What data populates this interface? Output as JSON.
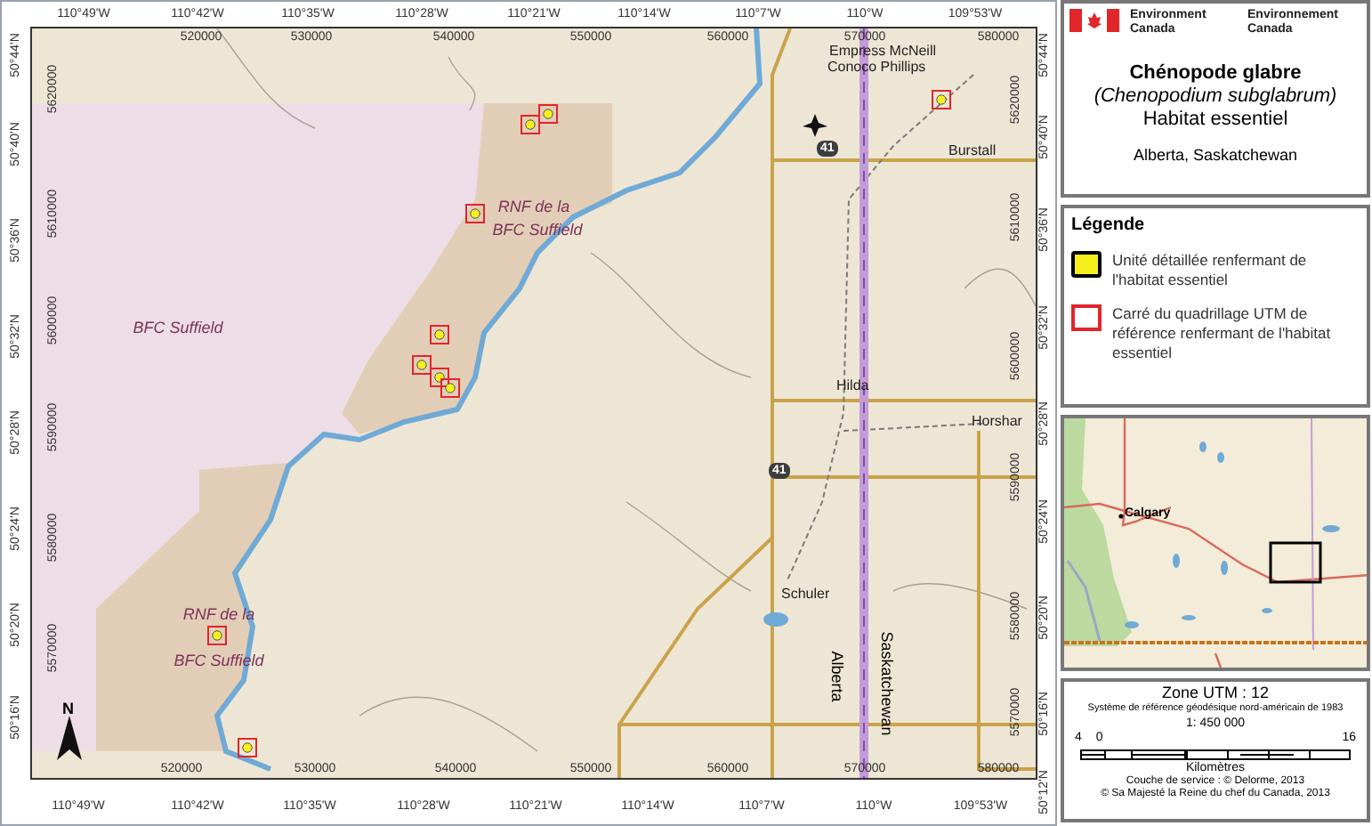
{
  "map": {
    "top_lon_labels": [
      "110°49'W",
      "110°42'W",
      "110°35'W",
      "110°28'W",
      "110°21'W",
      "110°14'W",
      "110°7'W",
      "110°W",
      "109°53'W"
    ],
    "bottom_lon_labels": [
      "110°49'W",
      "110°42'W",
      "110°35'W",
      "110°28'W",
      "110°21'W",
      "110°14'W",
      "110°7'W",
      "110°W",
      "109°53'W"
    ],
    "left_lat_labels": [
      "50°44'N",
      "50°40'N",
      "50°36'N",
      "50°32'N",
      "50°28'N",
      "50°24'N",
      "50°20'N",
      "50°16'N"
    ],
    "right_lat_labels": [
      "50°44'N",
      "50°40'N",
      "50°36'N",
      "50°32'N",
      "50°28'N",
      "50°24'N",
      "50°20'N",
      "50°16'N",
      "50°12'N"
    ],
    "top_easting_labels": [
      "520000",
      "530000",
      "540000",
      "550000",
      "560000",
      "570000",
      "580000"
    ],
    "bottom_easting_labels": [
      "520000",
      "530000",
      "540000",
      "550000",
      "560000",
      "570000",
      "580000"
    ],
    "left_northing_labels": [
      "5620000",
      "5610000",
      "5600000",
      "5590000",
      "5580000",
      "5570000"
    ],
    "right_northing_labels": [
      "5620000",
      "5610000",
      "5600000",
      "5590000",
      "5580000",
      "5570000"
    ],
    "place_labels": [
      {
        "text": "BFC Suffield",
        "kind": "area"
      },
      {
        "text": "RNF de la",
        "kind": "area"
      },
      {
        "text": "BFC Suffield",
        "kind": "area"
      },
      {
        "text": "RNF de la",
        "kind": "area"
      },
      {
        "text": "BFC Suffield",
        "kind": "area"
      },
      {
        "text": "Empress McNeill",
        "kind": "place"
      },
      {
        "text": "Conoco Phillips",
        "kind": "place"
      },
      {
        "text": "Burstall",
        "kind": "place"
      },
      {
        "text": "Hilda",
        "kind": "place"
      },
      {
        "text": "Horshar",
        "kind": "place"
      },
      {
        "text": "Schuler",
        "kind": "place"
      },
      {
        "text": "Alberta",
        "kind": "province"
      },
      {
        "text": "Saskatchewan",
        "kind": "province"
      },
      {
        "text": "41",
        "kind": "road"
      },
      {
        "text": "41",
        "kind": "road"
      }
    ],
    "north_label": "N"
  },
  "title_block": {
    "agency": [
      "Environment Canada",
      "Environnement Canada"
    ],
    "common_name": "Chénopode glabre",
    "scientific_name": "(Chenopodium subglabrum)",
    "subtitle": "Habitat essentiel",
    "region": "Alberta, Saskatchewan"
  },
  "legend": {
    "title": "Légende",
    "items": [
      {
        "kind": "unit",
        "label": "Unité détaillée renfermant de l'habitat essentiel"
      },
      {
        "kind": "grid",
        "label": "Carré du quadrillage UTM de référence renfermant de l'habitat essentiel"
      }
    ]
  },
  "inset_map": {
    "city": "Calgary"
  },
  "scale_block": {
    "zone": "Zone UTM : 12",
    "datum": "Système de référence géodésique nord-américain de 1983",
    "ratio": "1: 450 000",
    "ticks": [
      "4",
      "0",
      "16"
    ],
    "unit": "Kilomètres",
    "service": "Couche de service : © Delorme, 2013",
    "copyright": "© Sa Majesté la Reine du chef du Canada, 2013"
  }
}
